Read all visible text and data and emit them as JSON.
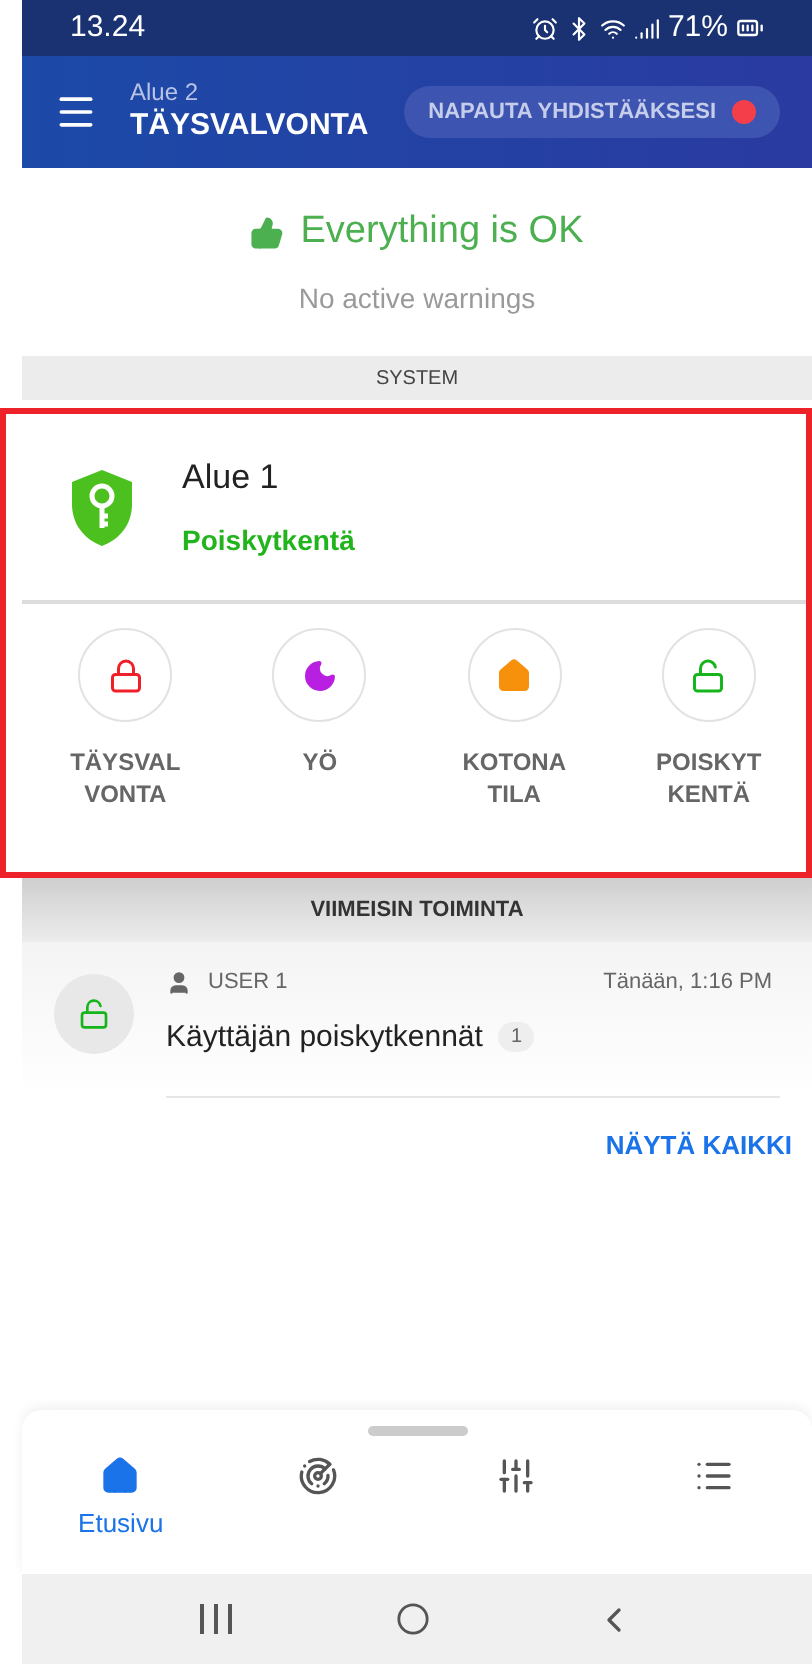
{
  "status_bar": {
    "time": "13.24",
    "battery": "71%"
  },
  "header": {
    "subtitle": "Alue 2",
    "title": "TÄYSVALVONTA",
    "connect_button": "NAPAUTA YHDISTÄÄKSESI",
    "connected": false
  },
  "status": {
    "title": "Everything is OK",
    "subtitle": "No active warnings"
  },
  "system_section": {
    "label": "SYSTEM"
  },
  "area": {
    "name": "Alue 1",
    "state": "Poiskytkentä",
    "highlighted": true,
    "modes": [
      {
        "kind": "lock",
        "label": "TÄYSVAL\nVONTA",
        "color": "#f0202a"
      },
      {
        "kind": "moon",
        "label": "YÖ",
        "color": "#b81fe0"
      },
      {
        "kind": "home",
        "label": "KOTONA\nTILA",
        "color": "#f7900a"
      },
      {
        "kind": "unlock",
        "label": "POISKYT\nKENTÄ",
        "color": "#17b51c"
      }
    ]
  },
  "recent": {
    "heading": "VIIMEISIN TOIMINTA",
    "items": [
      {
        "user": "USER 1",
        "time": "Tänään, 1:16 PM",
        "text": "Käyttäjän poiskytkennät",
        "count": "1"
      }
    ],
    "show_all": "NÄYTÄ KAIKKI"
  },
  "bottom_nav": [
    {
      "kind": "home",
      "label": "Etusivu",
      "selected": true
    },
    {
      "kind": "sensor",
      "selected": false
    },
    {
      "kind": "sliders",
      "selected": false
    },
    {
      "kind": "list",
      "selected": false
    }
  ]
}
